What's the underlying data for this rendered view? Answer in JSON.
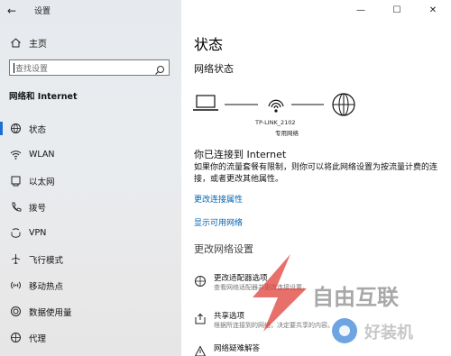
{
  "window": {
    "title": "设置",
    "minimize_glyph": "—",
    "maximize_glyph": "☐",
    "close_glyph": "✕"
  },
  "sidebar": {
    "back_glyph": "←",
    "home_label": "主页",
    "search_placeholder": "查找设置",
    "section_title": "网络和 Internet",
    "items": [
      {
        "label": "状态",
        "icon": "globe-status-icon",
        "active": true
      },
      {
        "label": "WLAN",
        "icon": "wifi-icon",
        "active": false
      },
      {
        "label": "以太网",
        "icon": "ethernet-icon",
        "active": false
      },
      {
        "label": "拨号",
        "icon": "dialup-icon",
        "active": false
      },
      {
        "label": "VPN",
        "icon": "vpn-icon",
        "active": false
      },
      {
        "label": "飞行模式",
        "icon": "airplane-icon",
        "active": false
      },
      {
        "label": "移动热点",
        "icon": "hotspot-icon",
        "active": false
      },
      {
        "label": "数据使用量",
        "icon": "data-usage-icon",
        "active": false
      },
      {
        "label": "代理",
        "icon": "proxy-icon",
        "active": false
      }
    ]
  },
  "main": {
    "title": "状态",
    "network_status_heading": "网络状态",
    "network_name": "TP-LINK_2102",
    "network_type": "专用网络",
    "connected_text": "你已连接到 Internet",
    "description": "如果你的流量套餐有限制，则你可以将此网络设置为按流量计费的连接，或者更改其他属性。",
    "link_change_properties": "更改连接属性",
    "link_show_networks": "显示可用网络",
    "change_settings_heading": "更改网络设置",
    "options": [
      {
        "title": "更改适配器选项",
        "desc": "查看网络适配器并更改连接设置。",
        "icon": "adapter-icon"
      },
      {
        "title": "共享选项",
        "desc": "根据所连接到的网络，决定要共享的内容。",
        "icon": "sharing-icon"
      },
      {
        "title": "网络疑难解答",
        "desc": "",
        "icon": "troubleshoot-icon"
      }
    ]
  },
  "watermark": {
    "brand_text": "自由互联",
    "site_text": "好装机"
  },
  "colors": {
    "accent": "#0063b1",
    "active_bar": "#1f6fd0",
    "watermark_red": "#e0403a"
  }
}
